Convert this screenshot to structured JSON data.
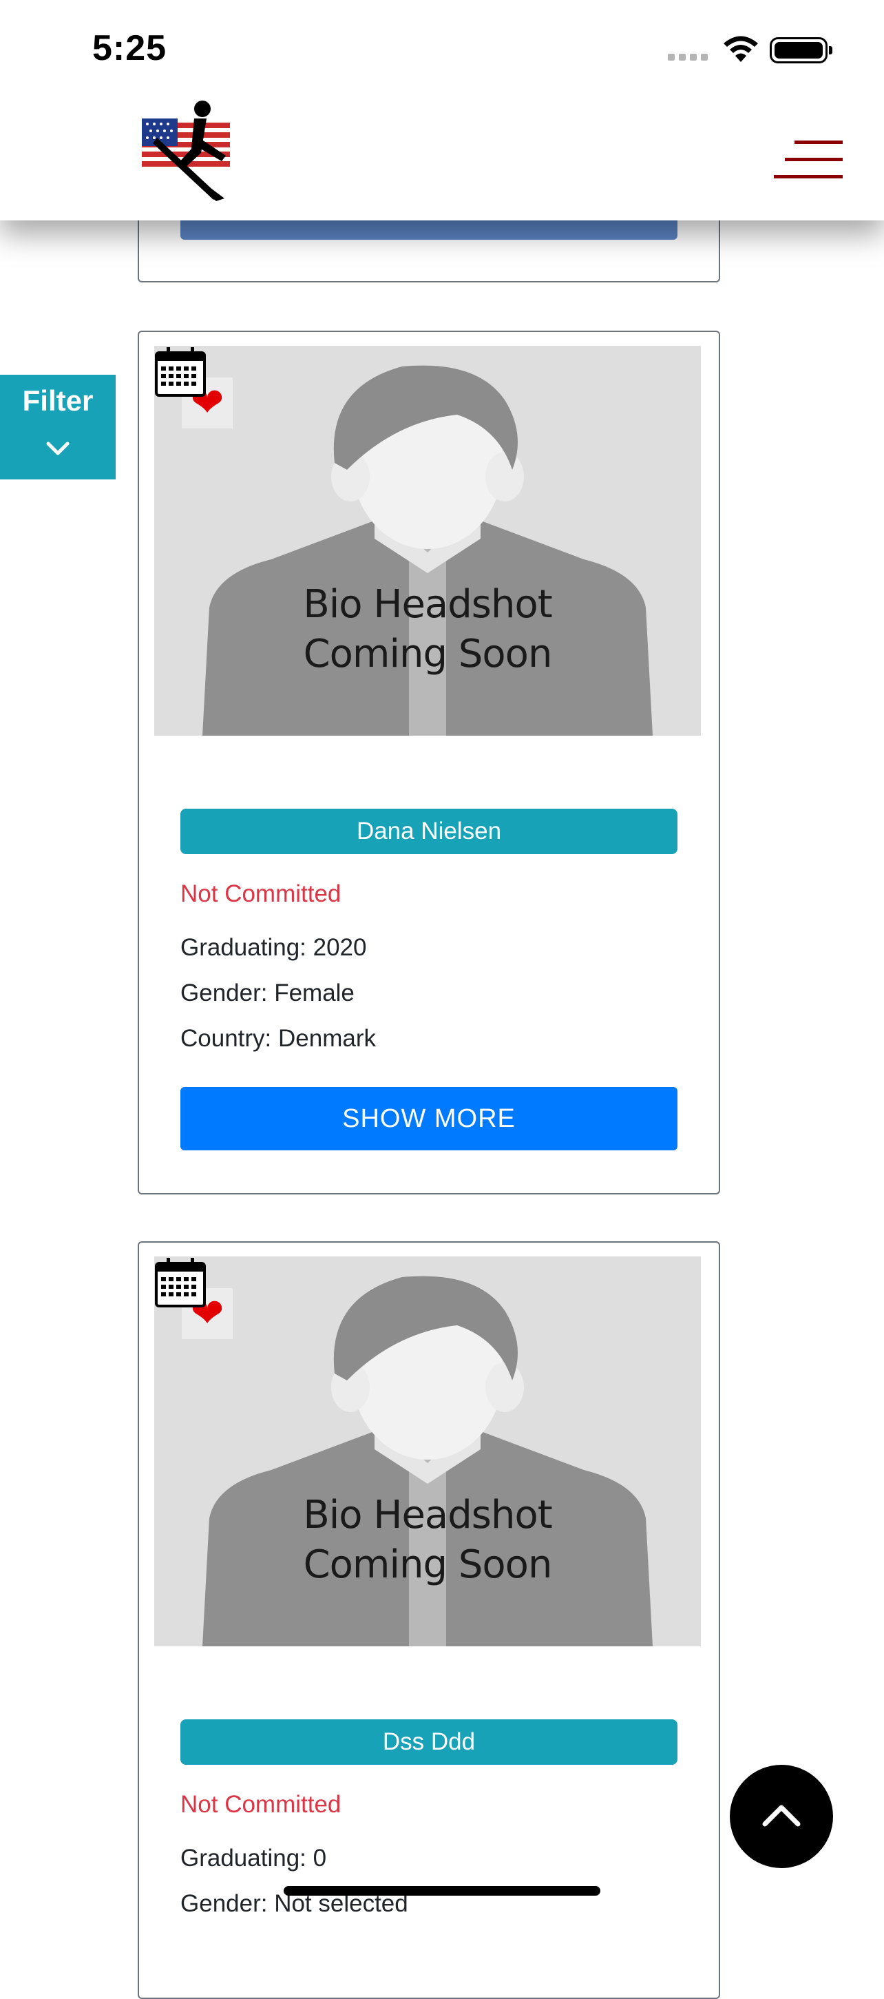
{
  "status_bar": {
    "time": "5:25"
  },
  "header": {
    "logo": "rower-flag-logo",
    "menu_icon": "hamburger-menu-icon"
  },
  "filter": {
    "label": "Filter"
  },
  "photo_caption": {
    "line1": "Bio Headshot",
    "line2": "Coming Soon"
  },
  "athletes": [
    {
      "name": "Dana Nielsen",
      "status": "Not Committed",
      "graduating": "Graduating: 2020",
      "gender": "Gender: Female",
      "country": "Country: Denmark",
      "button": "SHOW MORE"
    },
    {
      "name": "Dss Ddd",
      "status": "Not Committed",
      "graduating": "Graduating: 0",
      "gender": "Gender: Not selected"
    }
  ],
  "colors": {
    "teal": "#17a2b8",
    "blue": "#007bff",
    "red": "#dc3545",
    "menu": "#8b0000"
  }
}
